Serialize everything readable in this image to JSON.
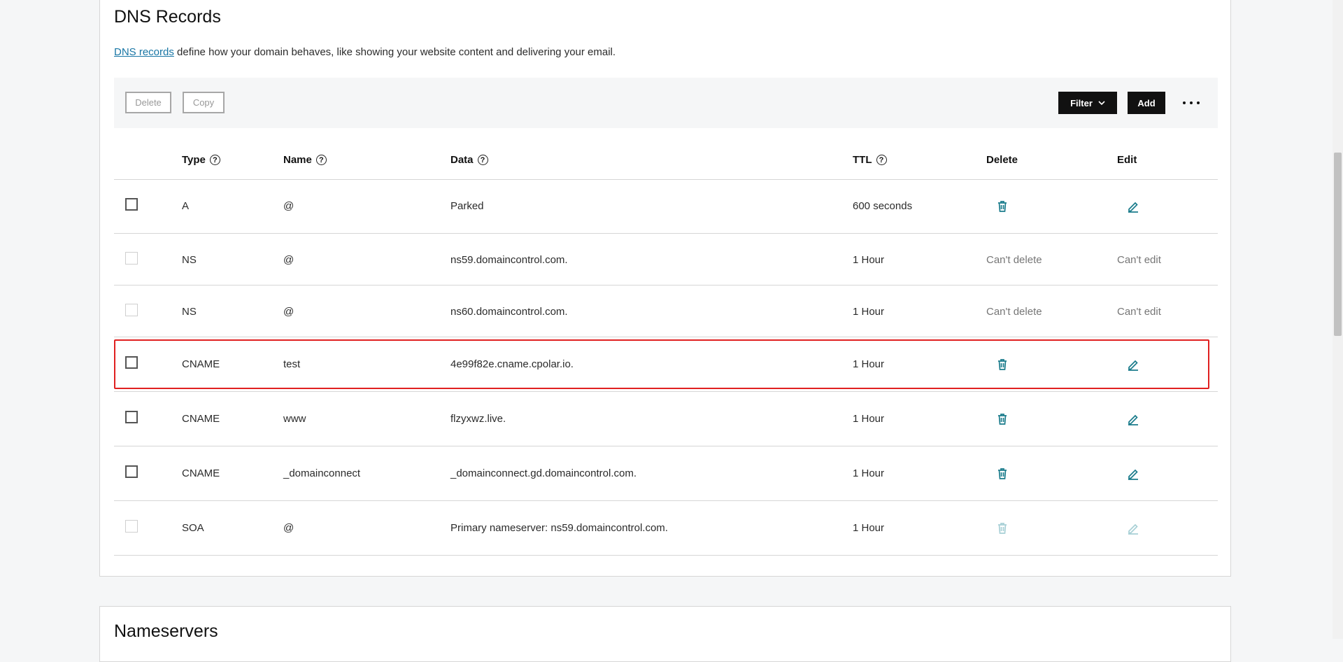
{
  "section_title": "DNS Records",
  "intro": {
    "link_text": "DNS records",
    "text": " define how your domain behaves, like showing your website content and delivering your email."
  },
  "toolbar": {
    "delete_label": "Delete",
    "copy_label": "Copy",
    "filter_label": "Filter",
    "add_label": "Add",
    "more_icon": "ellipsis-icon"
  },
  "table": {
    "headers": {
      "type": "Type",
      "name": "Name",
      "data": "Data",
      "ttl": "TTL",
      "delete": "Delete",
      "edit": "Edit"
    },
    "rows": [
      {
        "type": "A",
        "name": "@",
        "data": "Parked",
        "ttl": "600 seconds",
        "delete_text": "",
        "edit_text": ""
      },
      {
        "type": "NS",
        "name": "@",
        "data": "ns59.domaincontrol.com.",
        "ttl": "1 Hour",
        "delete_text": "Can't delete",
        "edit_text": "Can't edit"
      },
      {
        "type": "NS",
        "name": "@",
        "data": "ns60.domaincontrol.com.",
        "ttl": "1 Hour",
        "delete_text": "Can't delete",
        "edit_text": "Can't edit"
      },
      {
        "type": "CNAME",
        "name": "test",
        "data": "4e99f82e.cname.cpolar.io.",
        "ttl": "1 Hour",
        "delete_text": "",
        "edit_text": ""
      },
      {
        "type": "CNAME",
        "name": "www",
        "data": "flzyxwz.live.",
        "ttl": "1 Hour",
        "delete_text": "",
        "edit_text": ""
      },
      {
        "type": "CNAME",
        "name": "_domainconnect",
        "data": "_domainconnect.gd.domaincontrol.com.",
        "ttl": "1 Hour",
        "delete_text": "",
        "edit_text": ""
      },
      {
        "type": "SOA",
        "name": "@",
        "data": "Primary nameserver: ns59.domaincontrol.com.",
        "ttl": "1 Hour",
        "delete_text": "",
        "edit_text": ""
      }
    ]
  },
  "next_section_title": "Nameservers",
  "colors": {
    "accent": "#1976a5",
    "icon_teal": "#1b7c8c",
    "icon_teal_disabled": "#a8d0d6",
    "highlight": "#e02020"
  }
}
